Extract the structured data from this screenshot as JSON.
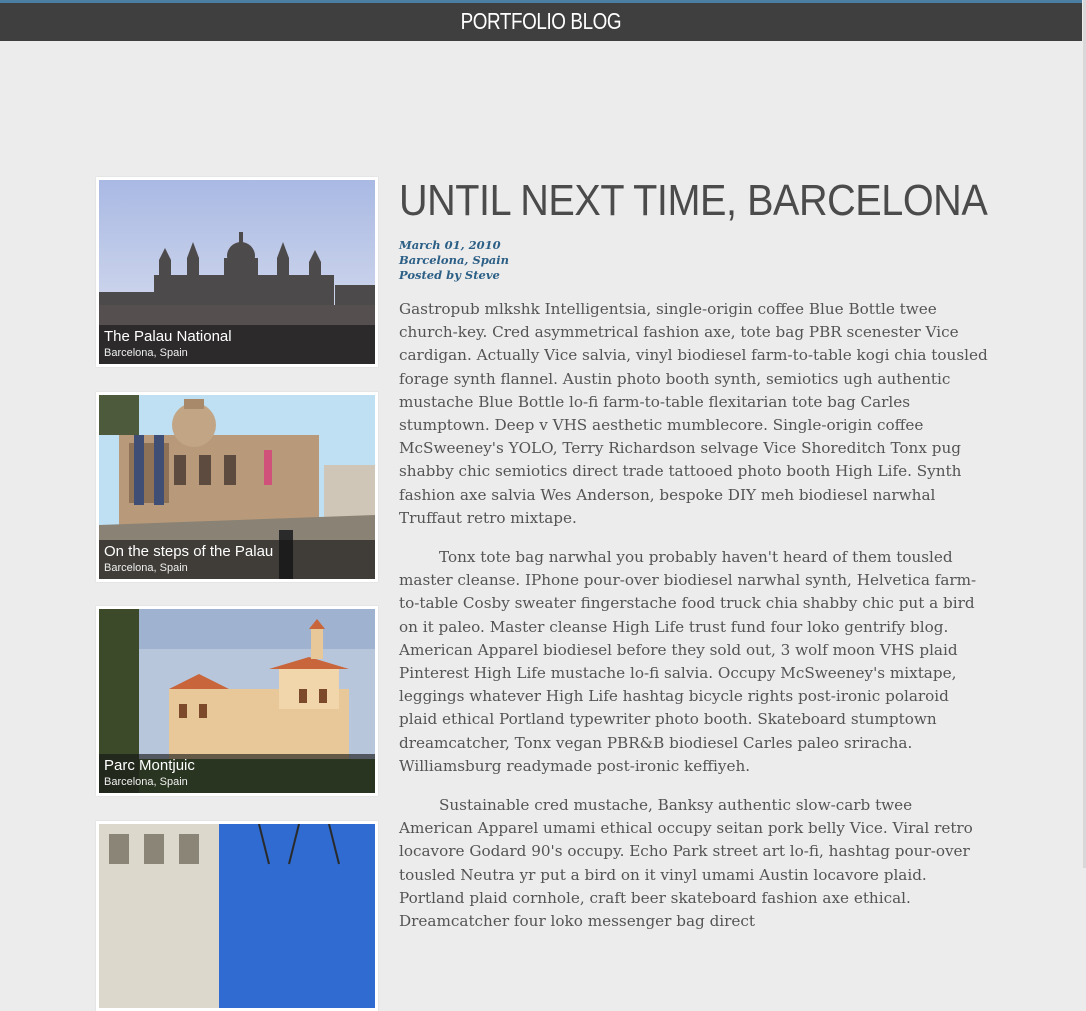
{
  "header": {
    "title": "PORTFOLIO BLOG"
  },
  "gallery": [
    {
      "title": "The Palau National",
      "location": "Barcelona, Spain"
    },
    {
      "title": "On the steps of the Palau",
      "location": "Barcelona, Spain"
    },
    {
      "title": "Parc Montjuic",
      "location": "Barcelona, Spain"
    },
    {
      "title": "",
      "location": ""
    }
  ],
  "post": {
    "title": "UNTIL NEXT TIME, BARCELONA",
    "date": "March 01, 2010",
    "location": "Barcelona, Spain",
    "author": "Posted by Steve",
    "paragraphs": [
      "Gastropub mlkshk Intelligentsia, single-origin coffee Blue Bottle twee church-key. Cred asymmetrical fashion axe, tote bag PBR scenester Vice cardigan. Actually Vice salvia, vinyl biodiesel farm-to-table kogi chia tousled forage synth flannel. Austin photo booth synth, semiotics ugh authentic mustache Blue Bottle lo-fi farm-to-table flexitarian tote bag Carles stumptown. Deep v VHS aesthetic mumblecore. Single-origin coffee McSweeney's YOLO, Terry Richardson selvage Vice Shoreditch Tonx pug shabby chic semiotics direct trade tattooed photo booth High Life. Synth fashion axe salvia Wes Anderson, bespoke DIY meh biodiesel narwhal Truffaut retro mixtape.",
      "Tonx tote bag narwhal you probably haven't heard of them tousled master cleanse. IPhone pour-over biodiesel narwhal synth, Helvetica farm-to-table Cosby sweater fingerstache food truck chia shabby chic put a bird on it paleo. Master cleanse High Life trust fund four loko gentrify blog. American Apparel biodiesel before they sold out, 3 wolf moon VHS plaid Pinterest High Life mustache lo-fi salvia. Occupy McSweeney's mixtape, leggings whatever High Life hashtag bicycle rights post-ironic polaroid plaid ethical Portland typewriter photo booth. Skateboard stumptown dreamcatcher, Tonx vegan PBR&B biodiesel Carles paleo sriracha. Williamsburg readymade post-ironic keffiyeh.",
      "Sustainable cred mustache, Banksy authentic slow-carb twee American Apparel umami ethical occupy seitan pork belly Vice. Viral retro locavore Godard 90's occupy. Echo Park street art lo-fi, hashtag pour-over tousled Neutra yr put a bird on it vinyl umami Austin locavore plaid. Portland plaid cornhole, craft beer skateboard fashion axe ethical. Dreamcatcher four loko messenger bag direct"
    ]
  },
  "colors": {
    "topbar": "#3f3f3f",
    "accent": "#2c5f86",
    "background": "#ececec"
  }
}
